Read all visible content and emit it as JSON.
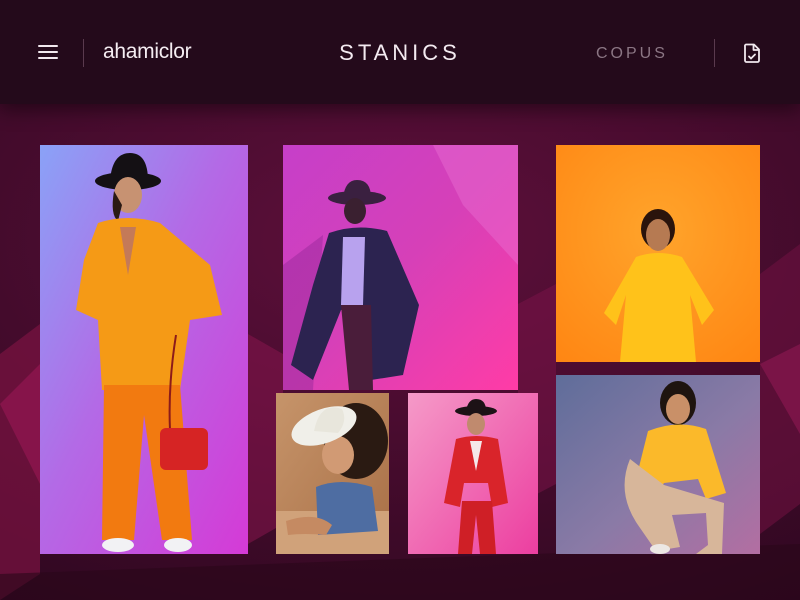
{
  "header": {
    "menu_icon": "hamburger-menu-icon",
    "brand": "ahamiclor",
    "title": "STANICS",
    "nav_link": "COPUS",
    "action_icon": "document-icon"
  },
  "gallery": {
    "items": [
      {
        "description": "person in orange suit with black hat and red bag"
      },
      {
        "description": "person in dark coat and hat on magenta background"
      },
      {
        "description": "woman in yellow outfit on orange background"
      },
      {
        "description": "child with white hat sitting on floor"
      },
      {
        "description": "woman in red suit with black hat"
      },
      {
        "description": "woman in yellow top kneeling"
      }
    ]
  },
  "colors": {
    "header_bg": "#240a1b",
    "page_bg": "#3d0a28",
    "text_light": "#f3eaf0",
    "text_muted": "#8b7684"
  }
}
